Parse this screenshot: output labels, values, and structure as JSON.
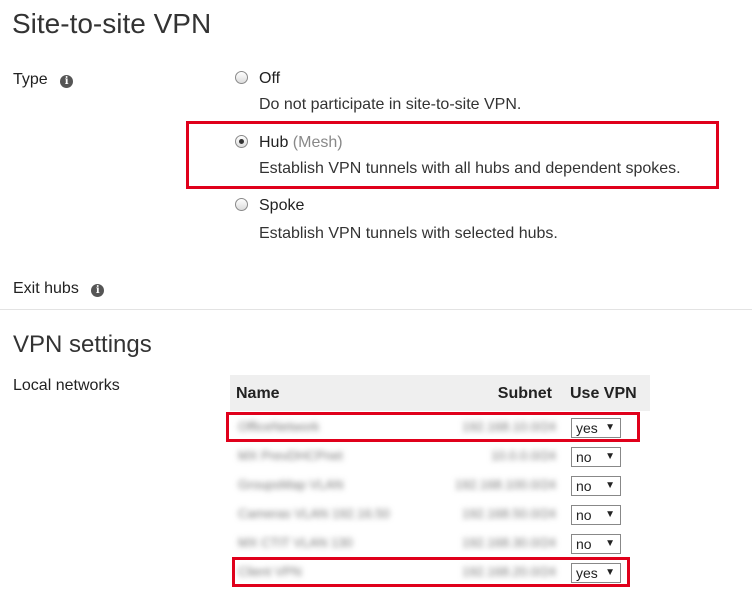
{
  "page_title": "Site-to-site VPN",
  "type_section": {
    "label": "Type",
    "info_icon": "info-icon",
    "options": [
      {
        "label": "Off",
        "suffix": "",
        "description": "Do not participate in site-to-site VPN.",
        "checked": false
      },
      {
        "label": "Hub",
        "suffix": " (Mesh)",
        "description": "Establish VPN tunnels with all hubs and dependent spokes.",
        "checked": true
      },
      {
        "label": "Spoke",
        "suffix": "",
        "description": "Establish VPN tunnels with selected hubs.",
        "checked": false
      }
    ]
  },
  "exit_hubs": {
    "label": "Exit hubs",
    "info_icon": "info-icon"
  },
  "vpn_settings": {
    "title": "VPN settings",
    "local_networks_label": "Local networks",
    "table": {
      "headers": {
        "name": "Name",
        "subnet": "Subnet",
        "use_vpn": "Use VPN"
      },
      "rows": [
        {
          "name": "OfficeNetwork",
          "subnet": "192.168.10.0/24",
          "use_vpn": "yes"
        },
        {
          "name": "MX PrevDHCPnet",
          "subnet": "10.0.0.0/24",
          "use_vpn": "no"
        },
        {
          "name": "GroupsMap VLAN",
          "subnet": "192.168.100.0/24",
          "use_vpn": "no"
        },
        {
          "name": "Cameras VLAN 192.16.50",
          "subnet": "192.168.50.0/24",
          "use_vpn": "no"
        },
        {
          "name": "MX CTIT VLAN 130",
          "subnet": "192.168.30.0/24",
          "use_vpn": "no"
        },
        {
          "name": "Client VPN",
          "subnet": "192.168.20.0/24",
          "use_vpn": "yes"
        }
      ]
    }
  },
  "colors": {
    "highlight": "#e0001b",
    "table_header_bg": "#efefef"
  }
}
